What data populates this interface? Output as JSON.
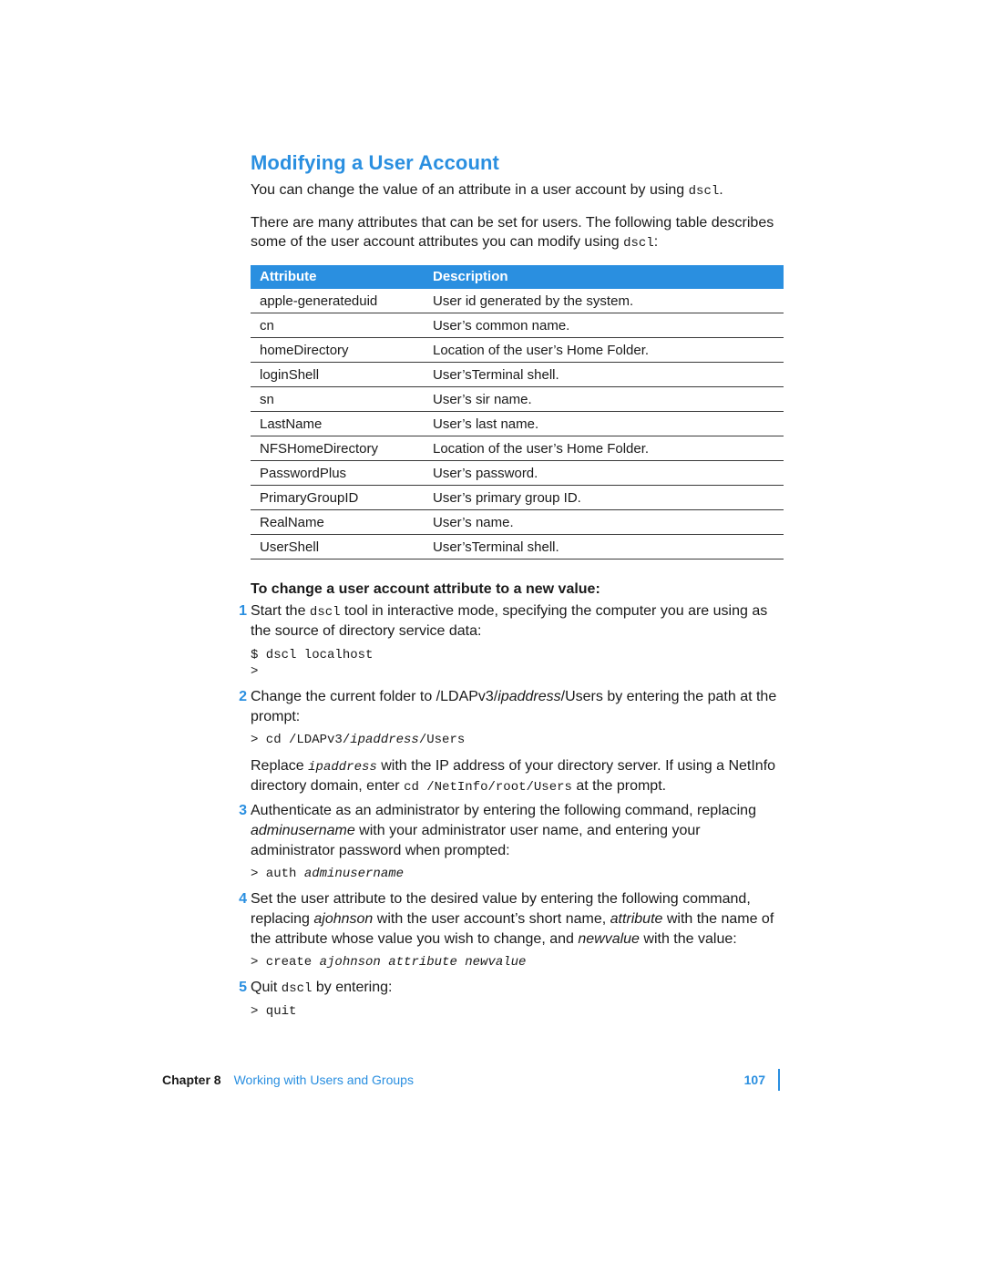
{
  "section": {
    "title": "Modifying a User Account",
    "intro_1_a": "You can change the value of an attribute in a user account by using ",
    "intro_1_code": "dscl",
    "intro_1_b": ".",
    "intro_2_a": "There are many attributes that can be set for users. The following table describes some of the user account attributes you can modify using ",
    "intro_2_code": "dscl",
    "intro_2_b": ":"
  },
  "table": {
    "headers": {
      "attribute": "Attribute",
      "description": "Description"
    },
    "rows": [
      {
        "attr": "apple-generateduid",
        "desc": "User id generated by the system."
      },
      {
        "attr": "cn",
        "desc": "User’s common name."
      },
      {
        "attr": "homeDirectory",
        "desc": "Location of the user’s Home Folder."
      },
      {
        "attr": "loginShell",
        "desc": "User’sTerminal shell."
      },
      {
        "attr": "sn",
        "desc": "User’s sir name."
      },
      {
        "attr": "LastName",
        "desc": "User’s last name."
      },
      {
        "attr": "NFSHomeDirectory",
        "desc": "Location of the user’s Home Folder."
      },
      {
        "attr": "PasswordPlus",
        "desc": "User’s password."
      },
      {
        "attr": "PrimaryGroupID",
        "desc": "User’s primary group ID."
      },
      {
        "attr": "RealName",
        "desc": "User’s name."
      },
      {
        "attr": "UserShell",
        "desc": "User’sTerminal shell."
      }
    ]
  },
  "procedure": {
    "title": "To change a user account attribute to a new value:",
    "steps": [
      {
        "num": "1",
        "parts": [
          {
            "t": "text",
            "v": "Start the "
          },
          {
            "t": "code",
            "v": "dscl"
          },
          {
            "t": "text",
            "v": " tool in interactive mode, specifying the computer you are using as the source of directory service data:"
          }
        ],
        "code": "$ dscl localhost\n>"
      },
      {
        "num": "2",
        "parts": [
          {
            "t": "text",
            "v": "Change the current folder to /LDAPv3/"
          },
          {
            "t": "ital",
            "v": "ipaddress"
          },
          {
            "t": "text",
            "v": "/Users by entering the path at the prompt:"
          }
        ],
        "code_parts": [
          {
            "t": "plain",
            "v": "> cd /LDAPv3/"
          },
          {
            "t": "ital",
            "v": "ipaddress"
          },
          {
            "t": "plain",
            "v": "/Users"
          }
        ],
        "after_parts": [
          {
            "t": "text",
            "v": "Replace "
          },
          {
            "t": "codeital",
            "v": "ipaddress"
          },
          {
            "t": "text",
            "v": " with the IP address of your directory server. If using a NetInfo directory domain, enter "
          },
          {
            "t": "code",
            "v": "cd /NetInfo/root/Users"
          },
          {
            "t": "text",
            "v": " at the prompt."
          }
        ]
      },
      {
        "num": "3",
        "parts": [
          {
            "t": "text",
            "v": "Authenticate as an administrator by entering the following command, replacing "
          },
          {
            "t": "ital",
            "v": "adminusername"
          },
          {
            "t": "text",
            "v": " with your administrator user name, and entering your administrator password when prompted:"
          }
        ],
        "code_parts": [
          {
            "t": "plain",
            "v": "> auth "
          },
          {
            "t": "ital",
            "v": "adminusername"
          }
        ]
      },
      {
        "num": "4",
        "parts": [
          {
            "t": "text",
            "v": "Set the user attribute to the desired value by entering the following command, replacing "
          },
          {
            "t": "ital",
            "v": "ajohnson"
          },
          {
            "t": "text",
            "v": " with the user account’s short name, "
          },
          {
            "t": "ital",
            "v": "attribute"
          },
          {
            "t": "text",
            "v": " with the name of the attribute whose value you wish to change, and "
          },
          {
            "t": "ital",
            "v": "newvalue"
          },
          {
            "t": "text",
            "v": " with the value:"
          }
        ],
        "code_parts": [
          {
            "t": "plain",
            "v": "> create "
          },
          {
            "t": "ital",
            "v": "ajohnson attribute newvalue"
          }
        ]
      },
      {
        "num": "5",
        "parts": [
          {
            "t": "text",
            "v": "Quit "
          },
          {
            "t": "code",
            "v": "dscl"
          },
          {
            "t": "text",
            "v": " by entering:"
          }
        ],
        "code": "> quit"
      }
    ]
  },
  "footer": {
    "chapter_label": "Chapter 8",
    "chapter_title": "Working with Users and Groups",
    "page_number": "107"
  }
}
